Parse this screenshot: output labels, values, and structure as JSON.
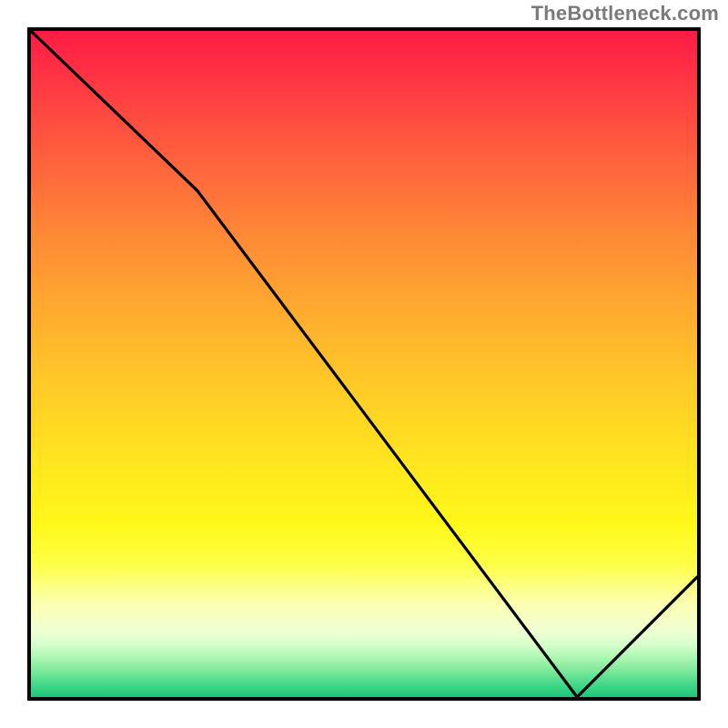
{
  "attribution": "TheBottleneck.com",
  "chart_data": {
    "type": "line",
    "title": "",
    "xlabel": "",
    "ylabel": "",
    "xlim": [
      0,
      100
    ],
    "ylim": [
      0,
      100
    ],
    "grid": false,
    "legend": false,
    "x": [
      0,
      25,
      82,
      100
    ],
    "values": [
      100,
      76,
      0,
      18
    ],
    "series_stroke": "#000000",
    "background_gradient": [
      {
        "stop": 0.0,
        "color": "#ff1c45"
      },
      {
        "stop": 0.5,
        "color": "#ffc728"
      },
      {
        "stop": 0.8,
        "color": "#fdff45"
      },
      {
        "stop": 1.0,
        "color": "#18c87a"
      }
    ],
    "marker": {
      "label": "",
      "x_pct": 78,
      "color": "#d13c1e"
    }
  }
}
